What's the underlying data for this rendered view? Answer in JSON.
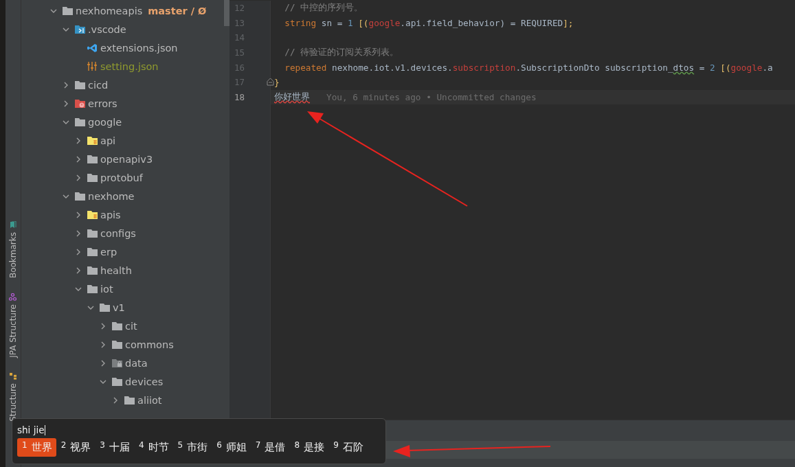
{
  "side_tabs": [
    {
      "label": "Bookmarks",
      "kind": "bookmarks"
    },
    {
      "label": "JPA Structure",
      "kind": "jpa"
    },
    {
      "label": "Structure",
      "kind": "structure"
    }
  ],
  "project_tree": {
    "root": {
      "name": "nexhomeapis",
      "branch": "master / Ø",
      "expanded": true
    },
    "children": [
      {
        "name": ".vscode",
        "kind": "vscode-folder",
        "expanded": true,
        "children": [
          {
            "name": "extensions.json",
            "kind": "vscode-file",
            "ignored": false
          },
          {
            "name": "setting.json",
            "kind": "settings-file",
            "ignored": true
          }
        ]
      },
      {
        "name": "cicd",
        "kind": "folder",
        "expanded": false
      },
      {
        "name": "errors",
        "kind": "error-folder",
        "expanded": false
      },
      {
        "name": "google",
        "kind": "folder",
        "expanded": true,
        "children": [
          {
            "name": "api",
            "kind": "source-folder",
            "expanded": false
          },
          {
            "name": "openapiv3",
            "kind": "folder",
            "expanded": false
          },
          {
            "name": "protobuf",
            "kind": "folder",
            "expanded": false
          }
        ]
      },
      {
        "name": "nexhome",
        "kind": "folder",
        "expanded": true,
        "children": [
          {
            "name": "apis",
            "kind": "source-folder",
            "expanded": false
          },
          {
            "name": "configs",
            "kind": "folder",
            "expanded": false
          },
          {
            "name": "erp",
            "kind": "folder",
            "expanded": false
          },
          {
            "name": "health",
            "kind": "folder",
            "expanded": false
          },
          {
            "name": "iot",
            "kind": "folder",
            "expanded": true,
            "children": [
              {
                "name": "v1",
                "kind": "folder",
                "expanded": true,
                "children": [
                  {
                    "name": "cit",
                    "kind": "folder",
                    "expanded": false
                  },
                  {
                    "name": "commons",
                    "kind": "folder",
                    "expanded": false
                  },
                  {
                    "name": "data",
                    "kind": "locked-folder",
                    "expanded": false
                  },
                  {
                    "name": "devices",
                    "kind": "folder",
                    "expanded": true,
                    "children": [
                      {
                        "name": "aliiot",
                        "kind": "folder",
                        "expanded": false
                      }
                    ]
                  }
                ]
              }
            ]
          }
        ]
      }
    ]
  },
  "editor": {
    "lines": [
      {
        "number": "12",
        "current": false,
        "tokens": [
          {
            "t": "  // 中控的序列号。",
            "kind": "comment"
          }
        ]
      },
      {
        "number": "13",
        "current": false,
        "tokens": [
          {
            "t": "  string",
            "kind": "keyword"
          },
          {
            "t": " sn = ",
            "kind": "plain"
          },
          {
            "t": "1",
            "kind": "number"
          },
          {
            "t": " [(",
            "kind": "bracket"
          },
          {
            "t": "google",
            "kind": "package"
          },
          {
            "t": ".api.field_behavior) = REQUIRED",
            "kind": "plain"
          },
          {
            "t": "];",
            "kind": "bracket"
          }
        ]
      },
      {
        "number": "14",
        "current": false
      },
      {
        "number": "15",
        "current": false,
        "tokens": [
          {
            "t": "  // 待验证的订阅关系列表。",
            "kind": "comment"
          }
        ]
      },
      {
        "number": "16",
        "current": false,
        "tokens": [
          {
            "t": "  repeated",
            "kind": "keyword"
          },
          {
            "t": " nexhome.iot.v1.devices.",
            "kind": "plain"
          },
          {
            "t": "subscription",
            "kind": "package"
          },
          {
            "t": ".SubscriptionDto subscription_",
            "kind": "plain"
          },
          {
            "t": "dtos",
            "kind": "typo"
          },
          {
            "t": " = ",
            "kind": "plain"
          },
          {
            "t": "2",
            "kind": "number"
          },
          {
            "t": " [(",
            "kind": "bracket"
          },
          {
            "t": "google",
            "kind": "package"
          },
          {
            "t": ".a",
            "kind": "plain"
          }
        ]
      },
      {
        "number": "17",
        "current": false,
        "fold": true,
        "tokens": [
          {
            "t": "}",
            "kind": "bracket"
          }
        ]
      },
      {
        "number": "18",
        "current": true,
        "tokens": [
          {
            "t": "你好世界",
            "kind": "error"
          }
        ],
        "blame": "You, 6 minutes ago • Uncommitted changes"
      }
    ]
  },
  "ime": {
    "composition": "shi jie",
    "candidates": [
      {
        "index": "1",
        "text": "世界",
        "selected": true
      },
      {
        "index": "2",
        "text": "视界",
        "selected": false
      },
      {
        "index": "3",
        "text": "十届",
        "selected": false
      },
      {
        "index": "4",
        "text": "时节",
        "selected": false
      },
      {
        "index": "5",
        "text": "市街",
        "selected": false
      },
      {
        "index": "6",
        "text": "师姐",
        "selected": false
      },
      {
        "index": "7",
        "text": "是借",
        "selected": false
      },
      {
        "index": "8",
        "text": "是接",
        "selected": false
      },
      {
        "index": "9",
        "text": "石阶",
        "selected": false
      }
    ]
  }
}
